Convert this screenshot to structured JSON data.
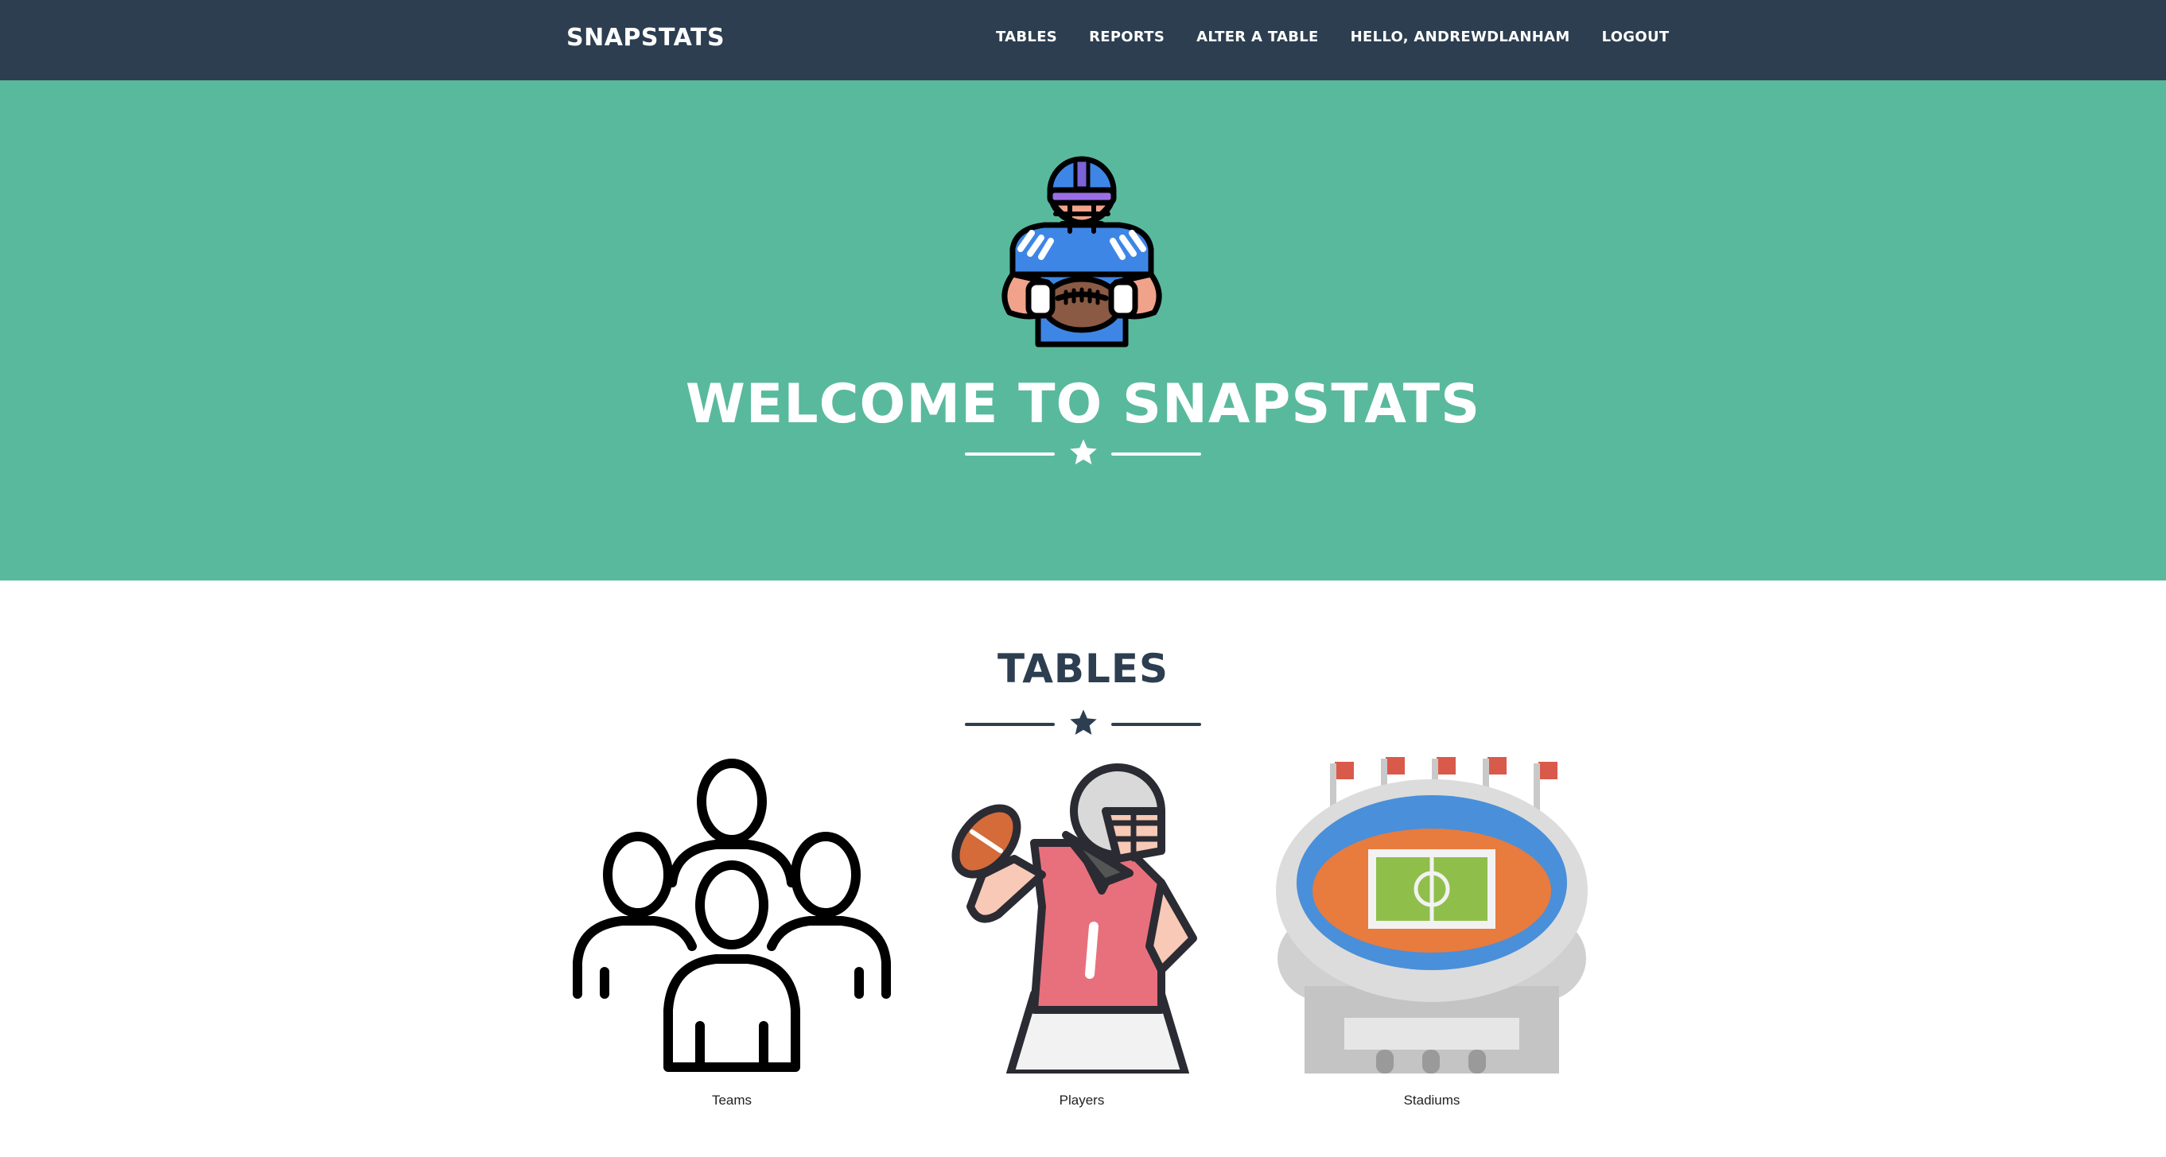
{
  "navbar": {
    "brand": "SNAPSTATS",
    "links": [
      "TABLES",
      "REPORTS",
      "ALTER A TABLE",
      "HELLO, ANDREWDLANHAM",
      "LOGOUT"
    ]
  },
  "masthead": {
    "title": "WELCOME TO SNAPSTATS",
    "avatar_icon": "football-player-holding-ball-icon",
    "divider_icon": "star-icon"
  },
  "tables_section": {
    "title": "TABLES",
    "divider_icon": "star-icon",
    "cards": [
      {
        "label": "Teams",
        "icon": "team-group-icon"
      },
      {
        "label": "Players",
        "icon": "quarterback-icon"
      },
      {
        "label": "Stadiums",
        "icon": "stadium-icon"
      }
    ]
  },
  "colors": {
    "navbar": "#2c3e50",
    "masthead": "#59b99c",
    "primary_text": "#2c3e50",
    "white": "#ffffff"
  }
}
